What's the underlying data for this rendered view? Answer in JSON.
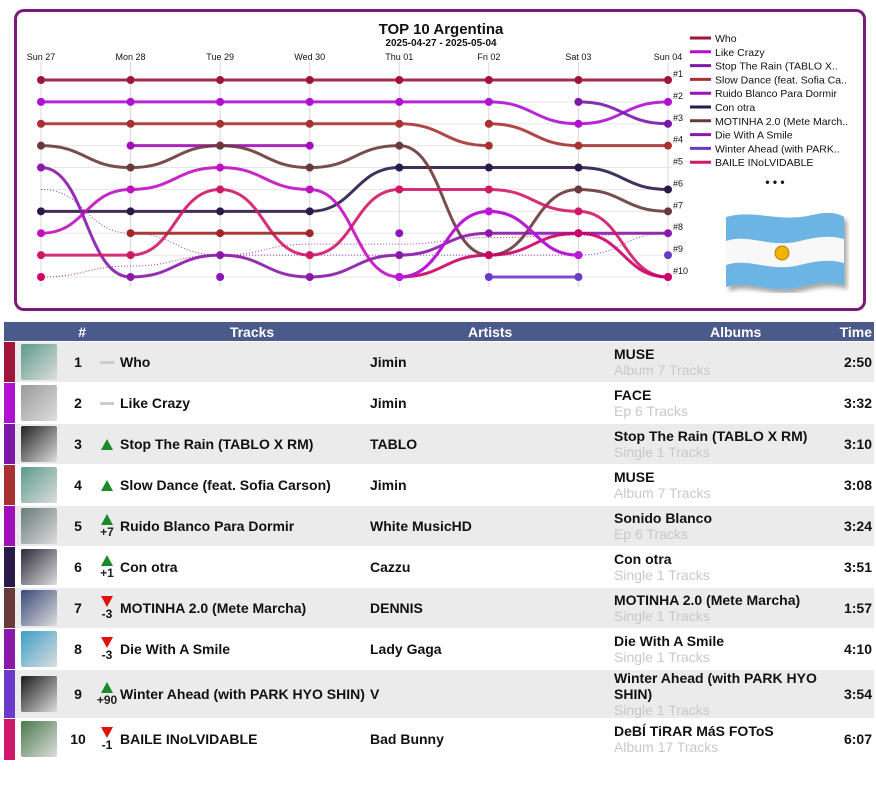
{
  "chart_data": {
    "type": "line",
    "title": "TOP 10 Argentina",
    "subtitle": "2025-04-27 - 2025-05-04",
    "x": [
      "Sun 27",
      "Mon 28",
      "Tue 29",
      "Wed 30",
      "Thu 01",
      "Fri 02",
      "Sat 03",
      "Sun 04"
    ],
    "rank_labels": [
      "#1",
      "#2",
      "#3",
      "#4",
      "#5",
      "#6",
      "#7",
      "#8",
      "#9",
      "#10"
    ],
    "ylim": [
      1,
      10
    ],
    "y_reversed": true,
    "legend_placement": "right",
    "legend_more": "• • •",
    "series": [
      {
        "name": "Who",
        "color": "#a0163a",
        "values": [
          1,
          1,
          1,
          1,
          1,
          1,
          1,
          1
        ]
      },
      {
        "name": "Like Crazy",
        "color": "#b010d0",
        "values": [
          2,
          2,
          2,
          2,
          2,
          2,
          3,
          2
        ]
      },
      {
        "name": "Stop The Rain (TABLO X RM)",
        "color": "#7a18a8",
        "values": [
          null,
          null,
          null,
          null,
          null,
          null,
          2,
          3
        ]
      },
      {
        "name": "Slow Dance (feat. Sofia Carson)",
        "color": "#a83232",
        "values": [
          3,
          3,
          3,
          3,
          3,
          4,
          null,
          null
        ]
      },
      {
        "name": "Slow Dance (feat. Sofia Carson)",
        "color": "#a83232",
        "values": [
          null,
          null,
          null,
          null,
          null,
          3,
          4,
          4
        ]
      },
      {
        "name": "Ruido Blanco Para Dormir",
        "color": "#a010b8",
        "values": [
          null,
          4,
          4,
          4,
          null,
          null,
          null,
          null
        ]
      },
      {
        "name": "Con otra",
        "color": "#2a1a4a",
        "values": [
          7,
          7,
          7,
          7,
          5,
          5,
          5,
          6
        ]
      },
      {
        "name": "MOTINHA 2.0 (Mete Marcha)",
        "color": "#6a3a3a",
        "values": [
          4,
          5,
          4,
          5,
          4,
          9,
          6,
          7
        ]
      },
      {
        "name": "Die With A Smile",
        "color": "#8a18a8",
        "values": [
          5,
          10,
          9,
          10,
          9,
          8,
          8,
          8
        ]
      },
      {
        "name": "Winter Ahead (with PARK HYO SHIN)",
        "color": "#6a3ac8",
        "values": [
          null,
          null,
          null,
          null,
          null,
          10,
          10,
          null
        ]
      },
      {
        "name": "BAILE INoLVIDABLE",
        "color": "#d01868",
        "values": [
          9,
          9,
          6,
          9,
          6,
          6,
          7,
          10
        ]
      },
      {
        "name": "Ruido Blanco Para Dormir",
        "color": "#c010c0",
        "values": [
          8,
          6,
          5,
          6,
          10,
          7,
          9,
          null
        ]
      },
      {
        "name": "",
        "color": "#cc0066",
        "values": [
          10,
          null,
          null,
          null,
          10,
          9,
          8,
          10
        ]
      },
      {
        "name": "",
        "color": "#a02828",
        "values": [
          null,
          8,
          8,
          8,
          null,
          null,
          null,
          null
        ]
      },
      {
        "name": "",
        "color": "#8a18b8",
        "values": [
          null,
          null,
          10,
          null,
          8,
          null,
          null,
          null
        ]
      },
      {
        "name": "",
        "color": "#b81ad8",
        "values": [
          null,
          null,
          null,
          null,
          10,
          7,
          9,
          null
        ]
      },
      {
        "name": "",
        "color": "#6a3ac8",
        "values": [
          null,
          null,
          null,
          null,
          null,
          null,
          null,
          9
        ]
      }
    ],
    "dotted_series": [
      {
        "color": "#8844cc",
        "values": [
          6,
          8,
          9,
          9,
          9,
          9,
          9,
          8
        ]
      },
      {
        "color": "#cc3388",
        "values": [
          10,
          9.5,
          9,
          8.5,
          8.5,
          8.2,
          8.1,
          8
        ]
      }
    ],
    "legend": [
      {
        "name": "Who",
        "color": "#a0163a"
      },
      {
        "name": "Like Crazy",
        "color": "#b010d0"
      },
      {
        "name": "Stop The Rain (TABLO X..",
        "color": "#7a18a8"
      },
      {
        "name": "Slow Dance (feat. Sofia Ca..",
        "color": "#a83232"
      },
      {
        "name": "Ruido Blanco Para Dormir",
        "color": "#a010b8"
      },
      {
        "name": "Con otra",
        "color": "#2a1a4a"
      },
      {
        "name": "MOTINHA 2.0 (Mete March..",
        "color": "#6a3a3a"
      },
      {
        "name": "Die With A Smile",
        "color": "#8a18a8"
      },
      {
        "name": "Winter Ahead (with PARK..",
        "color": "#6a3ac8"
      },
      {
        "name": "BAILE INoLVIDABLE",
        "color": "#d01868"
      }
    ]
  },
  "table": {
    "headers": {
      "rank": "#",
      "tracks": "Tracks",
      "artists": "Artists",
      "albums": "Albums",
      "time": "Time"
    },
    "rows": [
      {
        "rank": "1",
        "change": "same",
        "change_text": "",
        "track": "Who",
        "artist": "Jimin",
        "album": "MUSE",
        "album_meta": "Album 7 Tracks",
        "time": "2:50",
        "color": "#a0163a",
        "cover": "#5a9a8a"
      },
      {
        "rank": "2",
        "change": "same",
        "change_text": "",
        "track": "Like Crazy",
        "artist": "Jimin",
        "album": "FACE",
        "album_meta": "Ep 6 Tracks",
        "time": "3:32",
        "color": "#b010d0",
        "cover": "#9a9a9a"
      },
      {
        "rank": "3",
        "change": "up",
        "change_text": "",
        "track": "Stop The Rain (TABLO X RM)",
        "artist": "TABLO",
        "album": "Stop The Rain (TABLO X RM)",
        "album_meta": "Single 1 Tracks",
        "time": "3:10",
        "color": "#7a18a8",
        "cover": "#222222"
      },
      {
        "rank": "4",
        "change": "up",
        "change_text": "",
        "track": "Slow Dance (feat. Sofia Carson)",
        "artist": "Jimin",
        "album": "MUSE",
        "album_meta": "Album 7 Tracks",
        "time": "3:08",
        "color": "#a83232",
        "cover": "#5a9a8a"
      },
      {
        "rank": "5",
        "change": "up",
        "change_text": "+7",
        "track": "Ruido Blanco Para Dormir",
        "artist": "White MusicHD",
        "album": "Sonido Blanco",
        "album_meta": "Ep 6 Tracks",
        "time": "3:24",
        "color": "#a010b8",
        "cover": "#6a7a7a"
      },
      {
        "rank": "6",
        "change": "up",
        "change_text": "+1",
        "track": "Con otra",
        "artist": "Cazzu",
        "album": "Con otra",
        "album_meta": "Single 1 Tracks",
        "time": "3:51",
        "color": "#2a1a4a",
        "cover": "#2a2a3a"
      },
      {
        "rank": "7",
        "change": "down",
        "change_text": "-3",
        "track": "MOTINHA 2.0 (Mete Marcha)",
        "artist": "DENNIS",
        "album": "MOTINHA 2.0 (Mete Marcha)",
        "album_meta": "Single 1 Tracks",
        "time": "1:57",
        "color": "#6a3a3a",
        "cover": "#3a4a7a"
      },
      {
        "rank": "8",
        "change": "down",
        "change_text": "-3",
        "track": "Die With A Smile",
        "artist": "Lady Gaga",
        "album": "Die With A Smile",
        "album_meta": "Single 1 Tracks",
        "time": "4:10",
        "color": "#8a18a8",
        "cover": "#3aa0c8"
      },
      {
        "rank": "9",
        "change": "up",
        "change_text": "+90",
        "track": "Winter Ahead (with PARK HYO SHIN)",
        "artist": "V",
        "album": "Winter Ahead (with PARK HYO SHIN)",
        "album_meta": "Single 1 Tracks",
        "time": "3:54",
        "color": "#6a3ac8",
        "cover": "#1a1a1a"
      },
      {
        "rank": "10",
        "change": "down",
        "change_text": "-1",
        "track": "BAILE INoLVIDABLE",
        "artist": "Bad Bunny",
        "album": "DeBÍ TiRAR MáS FOToS",
        "album_meta": "Album 17 Tracks",
        "time": "6:07",
        "color": "#d01868",
        "cover": "#4a7a4a"
      }
    ]
  }
}
